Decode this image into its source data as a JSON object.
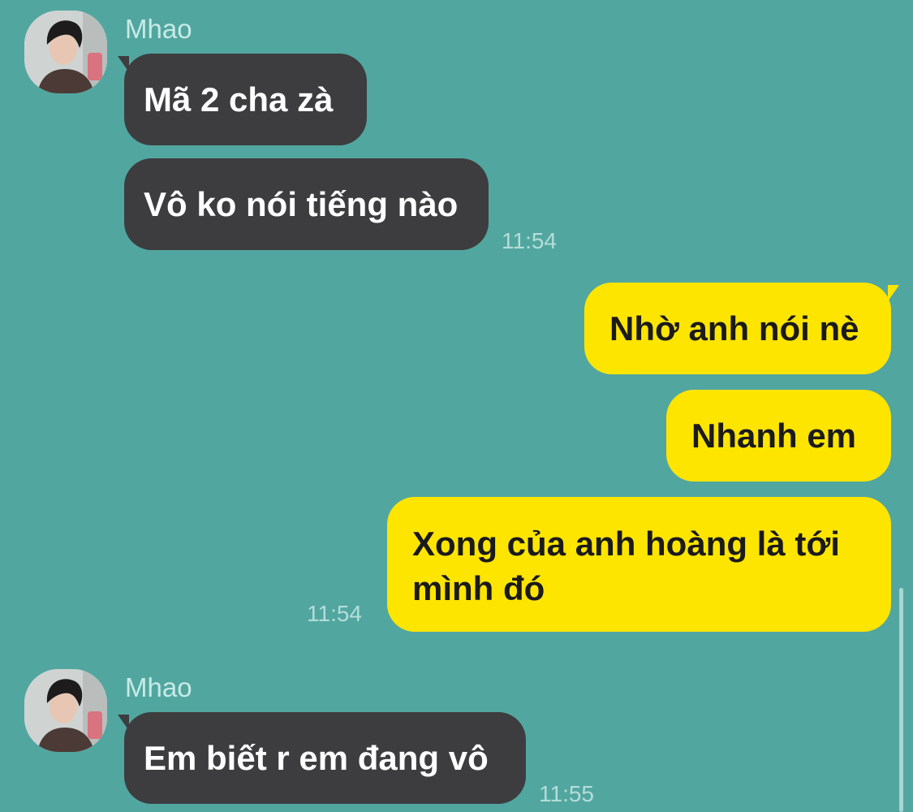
{
  "messages": [
    {
      "type": "sender",
      "name": "Mhao"
    },
    {
      "type": "incoming",
      "text": "Mã 2 cha zà"
    },
    {
      "type": "incoming",
      "text": "Vô ko nói tiếng nào",
      "time": "11:54"
    },
    {
      "type": "outgoing",
      "text": "Nhờ anh nói nè"
    },
    {
      "type": "outgoing",
      "text": "Nhanh em"
    },
    {
      "type": "outgoing",
      "lines": [
        "Xong của anh hoàng là tới",
        "mình đó"
      ],
      "time": "11:54"
    },
    {
      "type": "sender",
      "name": "Mhao"
    },
    {
      "type": "incoming",
      "text": "Em biết r em đang vô",
      "time": "11:55"
    }
  ],
  "colors": {
    "background": "#52a6a0",
    "incoming_bubble": "#3d3d3f",
    "outgoing_bubble": "#fee500",
    "sender_name": "#c7ebe6",
    "timestamp": "#b5ddd9"
  },
  "icons": {
    "avatar": "avatar-photo"
  }
}
